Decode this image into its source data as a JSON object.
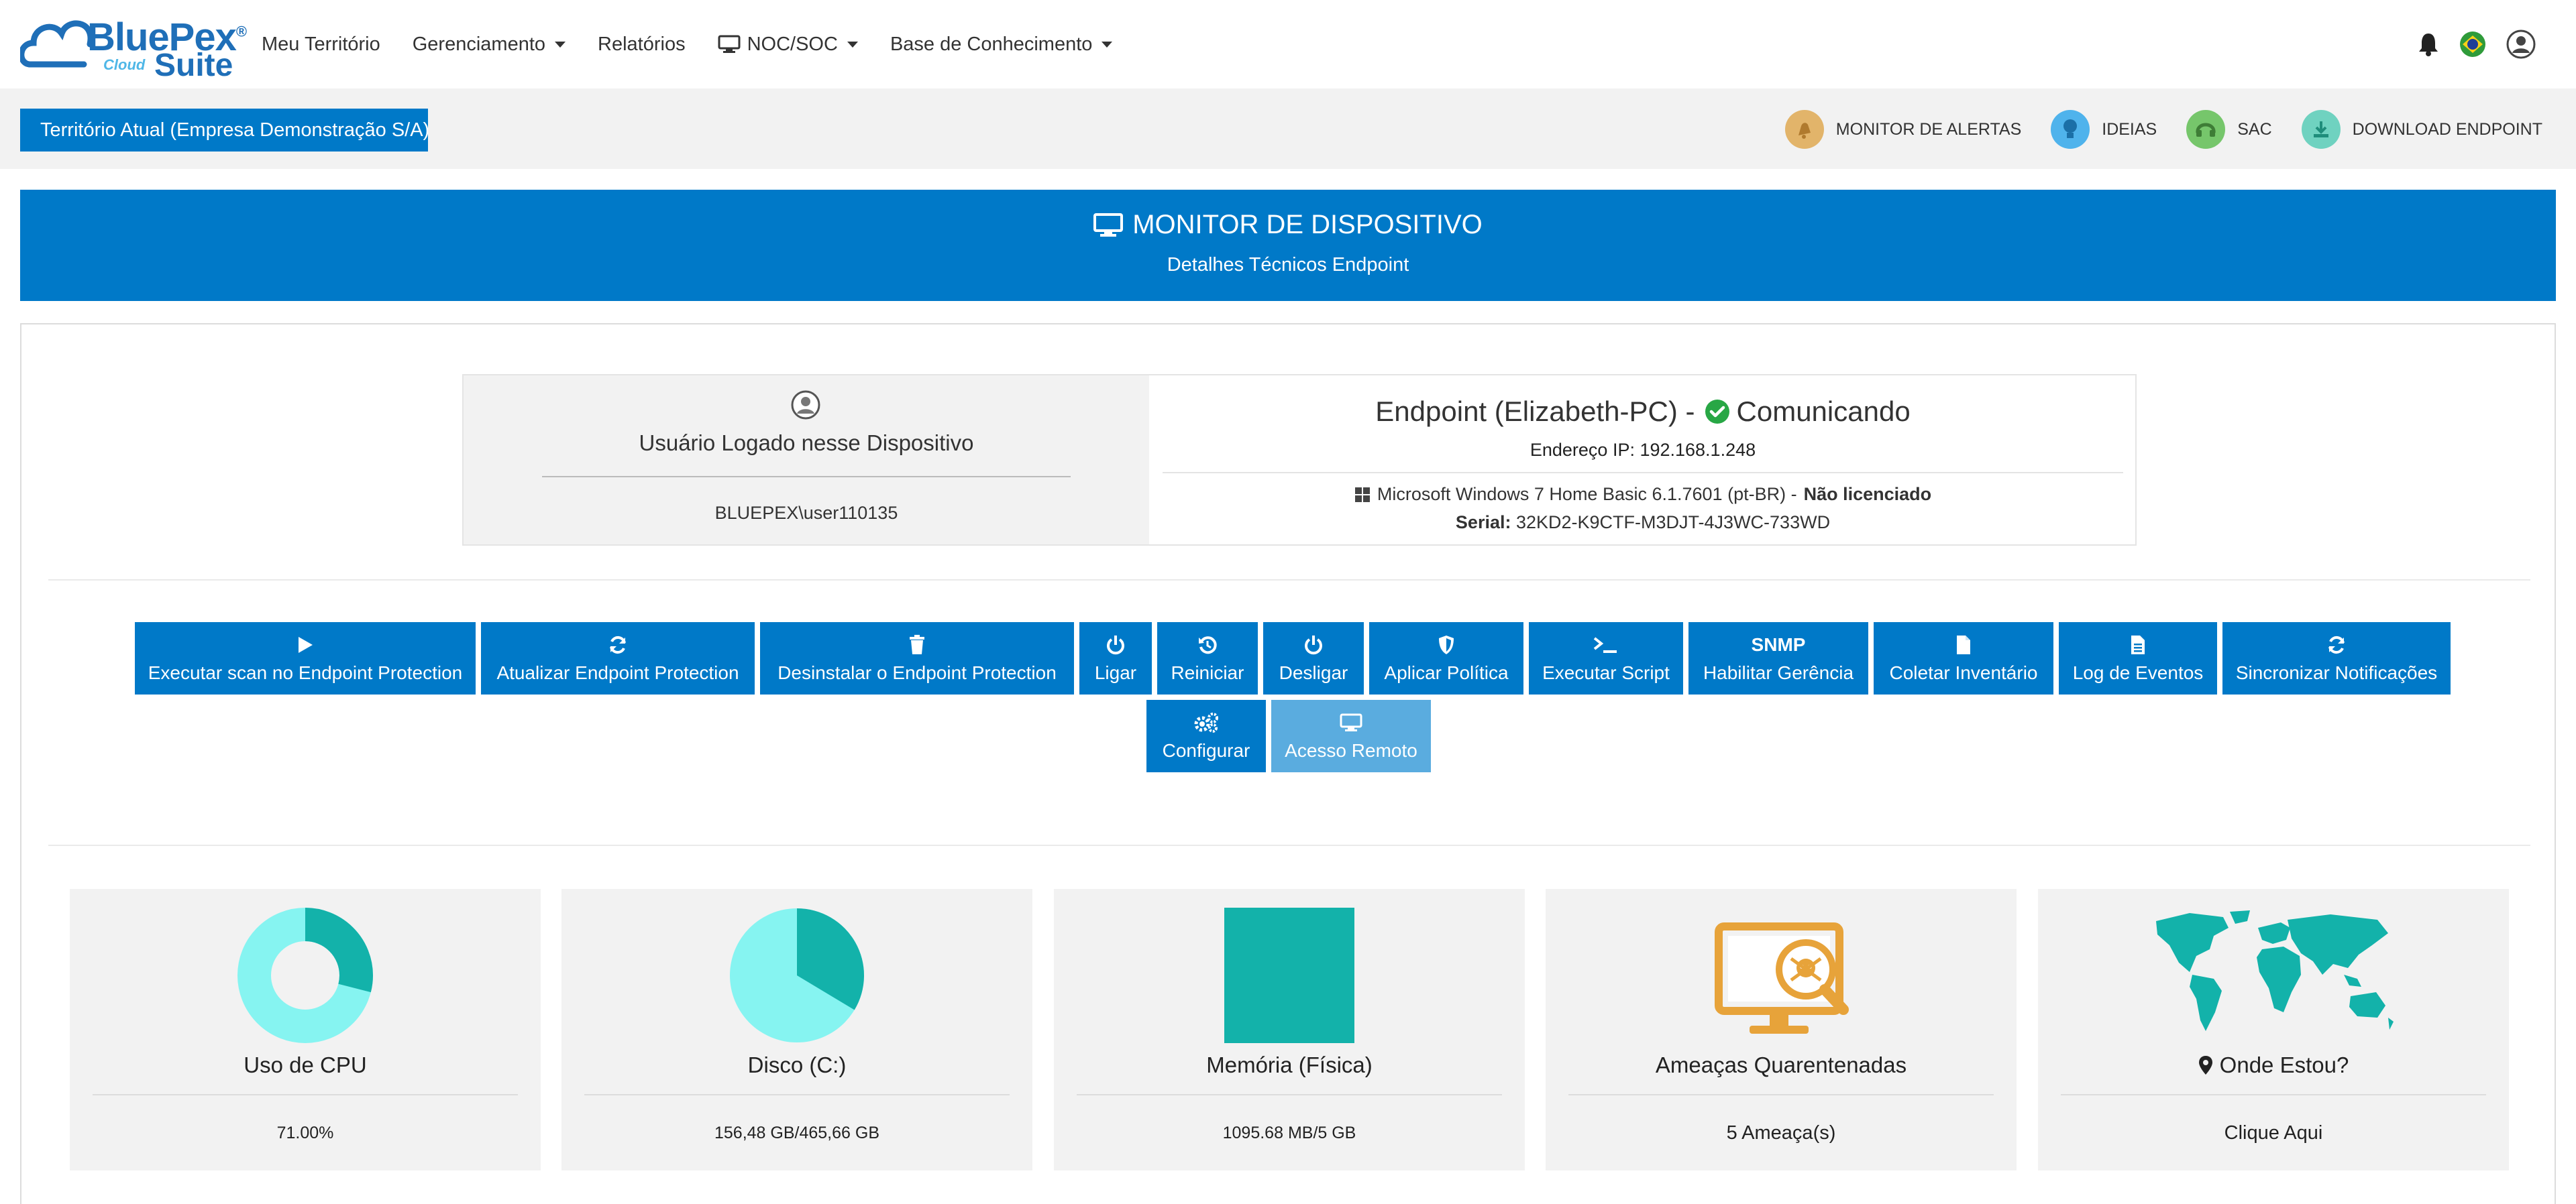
{
  "navbar": {
    "logo_brand": "BluePex",
    "logo_reg": "®",
    "logo_cloud": "Cloud",
    "logo_suite": "Suite",
    "menu": {
      "territory": "Meu Território",
      "management": "Gerenciamento",
      "reports": "Relatórios",
      "nocsoc": "NOC/SOC",
      "knowledge": "Base de Conhecimento"
    },
    "icons": [
      "bell-icon",
      "brazil-flag-icon",
      "user-profile-icon"
    ]
  },
  "subbar": {
    "territory_button": "Território Atual (Empresa Demonstração S/A)",
    "links": {
      "alerts": "MONITOR DE ALERTAS",
      "ideas": "IDEIAS",
      "sac": "SAC",
      "download": "DOWNLOAD ENDPOINT"
    },
    "colors": {
      "alerts": "#e2b46a",
      "ideas": "#4fb3ec",
      "sac": "#76c66b",
      "download": "#6fd2c0"
    }
  },
  "header": {
    "title": "MONITOR DE DISPOSITIVO",
    "subtitle": "Detalhes Técnicos Endpoint",
    "color": "#0079c8"
  },
  "endpoint": {
    "user_title": "Usuário Logado nesse Dispositivo",
    "user_name": "BLUEPEX\\user110135",
    "title_prefix": "Endpoint (Elizabeth-PC) -",
    "status": "Comunicando",
    "ip": "Endereço IP: 192.168.1.248",
    "os": "Microsoft Windows 7 Home Basic 6.1.7601 (pt-BR) -",
    "license": "Não licenciado",
    "serial_label": "Serial:",
    "serial_value": "32KD2-K9CTF-M3DJT-4J3WC-733WD"
  },
  "actions": {
    "scan": "Executar scan no Endpoint Protection",
    "update": "Atualizar Endpoint Protection",
    "uninstall": "Desinstalar o Endpoint Protection",
    "power_on": "Ligar",
    "restart": "Reiniciar",
    "shutdown": "Desligar",
    "policy": "Aplicar Política",
    "script": "Executar Script",
    "snmp_icon_text": "SNMP",
    "snmp": "Habilitar Gerência",
    "inventory": "Coletar Inventário",
    "events": "Log de Eventos",
    "sync": "Sincronizar Notificações",
    "configure": "Configurar",
    "remote": "Acesso Remoto"
  },
  "stats": {
    "cpu": {
      "title": "Uso de CPU",
      "value": "71.00%",
      "percent": 71
    },
    "disk": {
      "title": "Disco (C:)",
      "value": "156,48 GB/465,66 GB",
      "used_gb": 156.48,
      "total_gb": 465.66
    },
    "memory": {
      "title": "Memória (Física)",
      "value": "1095.68 MB/5 GB"
    },
    "threats": {
      "title": "Ameaças Quarentenadas",
      "value": "5 Ameaça(s)"
    },
    "location": {
      "title": "Onde Estou?",
      "value": "Clique Aqui"
    },
    "colors": {
      "light": "#86f4f1",
      "dark": "#13b2aa",
      "threat": "#e7a33a"
    }
  }
}
